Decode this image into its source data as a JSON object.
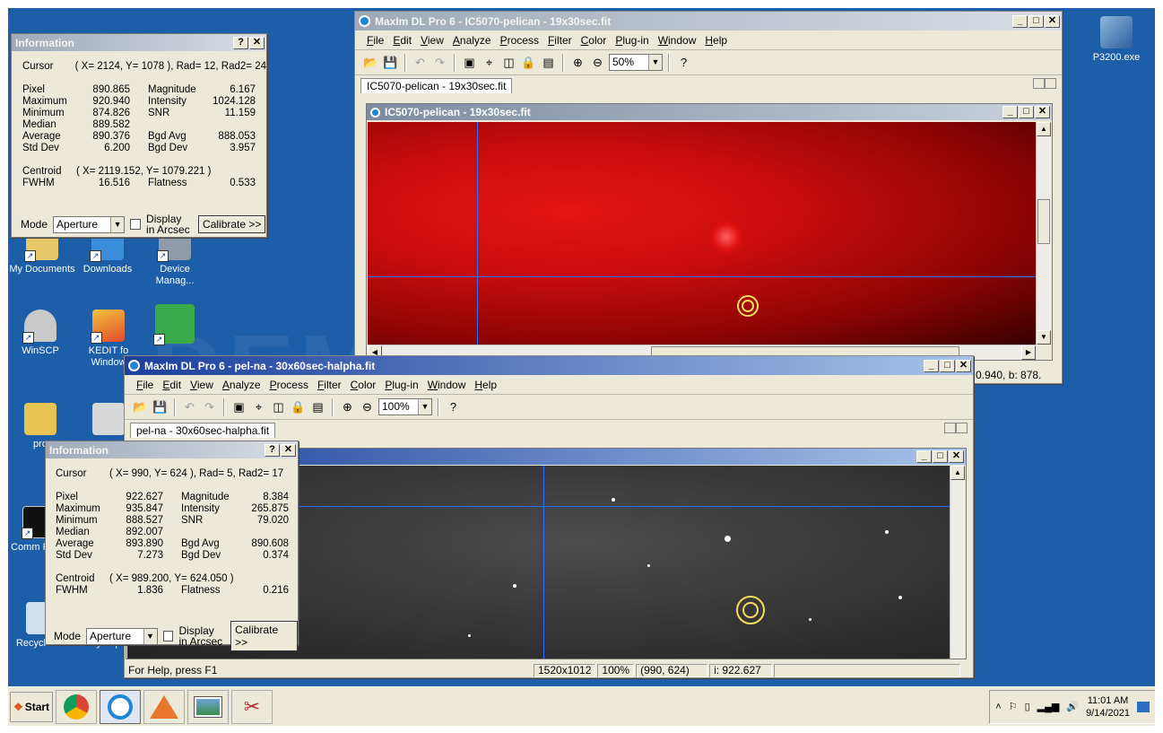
{
  "desktop": {
    "icons": [
      {
        "label": "My Documents",
        "icon": "folder-docs-icon"
      },
      {
        "label": "Downloads",
        "icon": "downloads-icon"
      },
      {
        "label": "Device Manag...",
        "icon": "device-manager-icon"
      },
      {
        "label": "WinSCP",
        "icon": "winscp-icon"
      },
      {
        "label": "KEDIT fo Window",
        "icon": "kedit-icon"
      },
      {
        "label": "pro",
        "icon": "folder-icon"
      },
      {
        "label": "Comm Prom",
        "icon": "cmd-icon"
      },
      {
        "label": "Recycle Bin",
        "icon": "recycle-bin-icon"
      },
      {
        "label": "SkyMap Pi",
        "icon": "skymap-icon"
      },
      {
        "label": "P3200.exe",
        "icon": "installer-icon"
      }
    ],
    "watermark": "DEMO VERSION"
  },
  "win1": {
    "title": "MaxIm DL Pro 6 - IC5070-pelican - 19x30sec.fit",
    "menu": [
      "File",
      "Edit",
      "View",
      "Analyze",
      "Process",
      "Filter",
      "Color",
      "Plug-in",
      "Window",
      "Help"
    ],
    "zoom": "50%",
    "tab": "IC5070-pelican - 19x30sec.fit",
    "doc_title": "IC5070-pelican - 19x30sec.fit",
    "status_partial": "0.940, b:  878."
  },
  "win2": {
    "title": "MaxIm DL Pro 6 - pel-na - 30x60sec-halpha.fit",
    "menu": [
      "File",
      "Edit",
      "View",
      "Analyze",
      "Process",
      "Filter",
      "Color",
      "Plug-in",
      "Window",
      "Help"
    ],
    "zoom": "100%",
    "tab": "pel-na - 30x60sec-halpha.fit",
    "status": {
      "help": "For Help, press F1",
      "dims": "1520x1012",
      "zoom": "100%",
      "coords": "(990, 624)",
      "value": "i:  922.627"
    }
  },
  "info1": {
    "title": "Information",
    "cursor_label": "Cursor",
    "cursor": "( X= 2124, Y= 1078 ), Rad= 12, Rad2= 24",
    "rows": [
      [
        "Pixel",
        "890.865",
        "Magnitude",
        "6.167"
      ],
      [
        "Maximum",
        "920.940",
        "Intensity",
        "1024.128"
      ],
      [
        "Minimum",
        "874.826",
        "SNR",
        "11.159"
      ],
      [
        "Median",
        "889.582",
        "",
        ""
      ],
      [
        "Average",
        "890.376",
        "Bgd Avg",
        "888.053"
      ],
      [
        "Std Dev",
        "6.200",
        "Bgd Dev",
        "3.957"
      ]
    ],
    "centroid_label": "Centroid",
    "centroid": "( X= 2119.152, Y= 1079.221 )",
    "fwhm_label": "FWHM",
    "fwhm": "16.516",
    "flatness_label": "Flatness",
    "flatness": "0.533",
    "mode_label": "Mode",
    "mode": "Aperture",
    "display_arcsec": "Display in Arcsec",
    "calibrate": "Calibrate >>"
  },
  "info2": {
    "title": "Information",
    "cursor_label": "Cursor",
    "cursor": "( X=  990, Y=  624 ), Rad=  5, Rad2= 17",
    "rows": [
      [
        "Pixel",
        "922.627",
        "Magnitude",
        "8.384"
      ],
      [
        "Maximum",
        "935.847",
        "Intensity",
        "265.875"
      ],
      [
        "Minimum",
        "888.527",
        "SNR",
        "79.020"
      ],
      [
        "Median",
        "892.007",
        "",
        ""
      ],
      [
        "Average",
        "893.890",
        "Bgd Avg",
        "890.608"
      ],
      [
        "Std Dev",
        "7.273",
        "Bgd Dev",
        "0.374"
      ]
    ],
    "centroid_label": "Centroid",
    "centroid": "( X=  989.200, Y=  624.050 )",
    "fwhm_label": "FWHM",
    "fwhm": "1.836",
    "flatness_label": "Flatness",
    "flatness": "0.216",
    "mode_label": "Mode",
    "mode": "Aperture",
    "display_arcsec": "Display in Arcsec",
    "calibrate": "Calibrate >>"
  },
  "taskbar": {
    "start": "Start",
    "time": "11:01 AM",
    "date": "9/14/2021"
  }
}
